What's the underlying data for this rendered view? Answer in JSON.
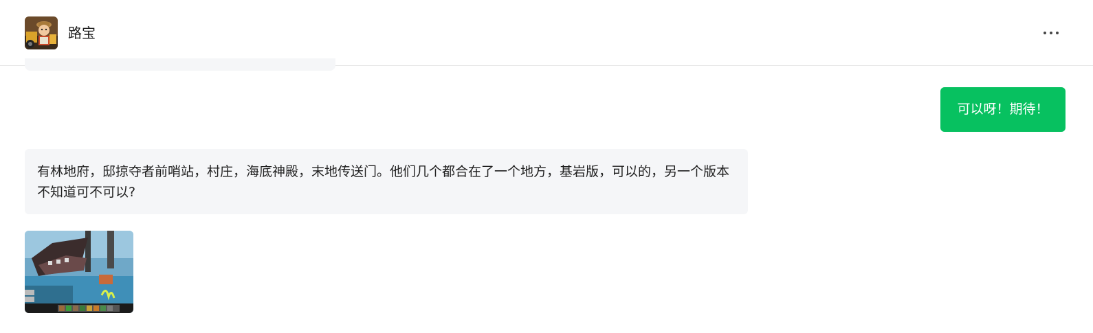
{
  "header": {
    "contact_name": "路宝",
    "avatar_icon": "avatar-cartoon-explorer",
    "more_icon": "more-horizontal-icon"
  },
  "messages": [
    {
      "direction": "sent",
      "text": "可以呀！期待！"
    },
    {
      "direction": "received",
      "text": "有林地府，邸掠夺者前哨站，村庄，海底神殿，末地传送门。他们几个都合在了一个地方，基岩版，可以的，另一个版本不知道可不可以?"
    },
    {
      "direction": "received",
      "type": "image",
      "image_icon": "game-screenshot-image"
    }
  ],
  "colors": {
    "sent_bubble": "#07c160",
    "received_bubble": "#f5f6f8",
    "background": "#ffffff"
  }
}
